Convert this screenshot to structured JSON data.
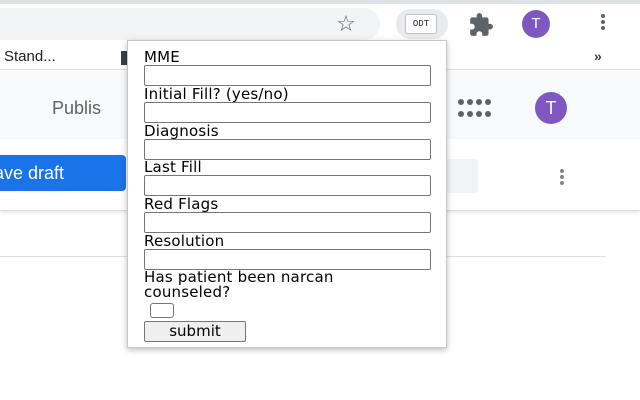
{
  "browser": {
    "bookmark_label": "Stand...",
    "bookmarks_overflow": "»",
    "star_glyph": "☆",
    "extension_label": "ODT",
    "profile_initial": "T"
  },
  "app": {
    "publish_label": "Publis",
    "save_draft_label": "ave draft",
    "profile_initial": "T",
    "accent_color": "#1a73e8",
    "avatar_color": "#7e57c2"
  },
  "popup": {
    "fields": [
      {
        "label": "MME",
        "value": ""
      },
      {
        "label": "Initial Fill? (yes/no)",
        "value": ""
      },
      {
        "label": "Diagnosis",
        "value": ""
      },
      {
        "label": "Last Fill",
        "value": ""
      },
      {
        "label": "Red Flags",
        "value": ""
      },
      {
        "label": "Resolution",
        "value": ""
      }
    ],
    "narcan_label": "Has patient been narcan counseled?",
    "narcan_checked": false,
    "submit_label": "submit"
  }
}
